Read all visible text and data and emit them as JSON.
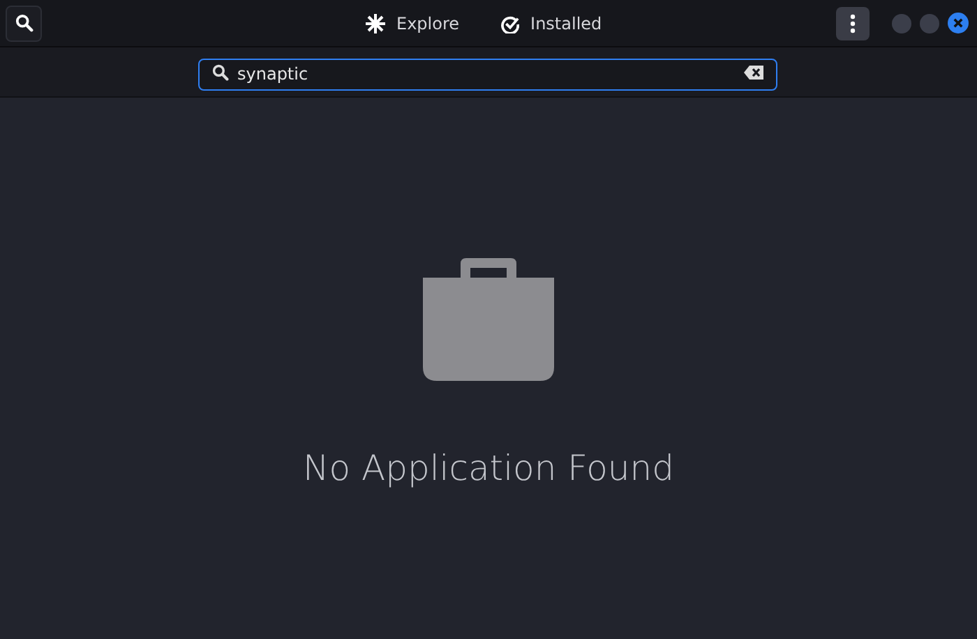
{
  "header": {
    "tabs": [
      {
        "label": "Explore",
        "selected": false
      },
      {
        "label": "Installed",
        "selected": false
      }
    ]
  },
  "search": {
    "value": "synaptic"
  },
  "empty_state": {
    "message": "No Application Found"
  }
}
